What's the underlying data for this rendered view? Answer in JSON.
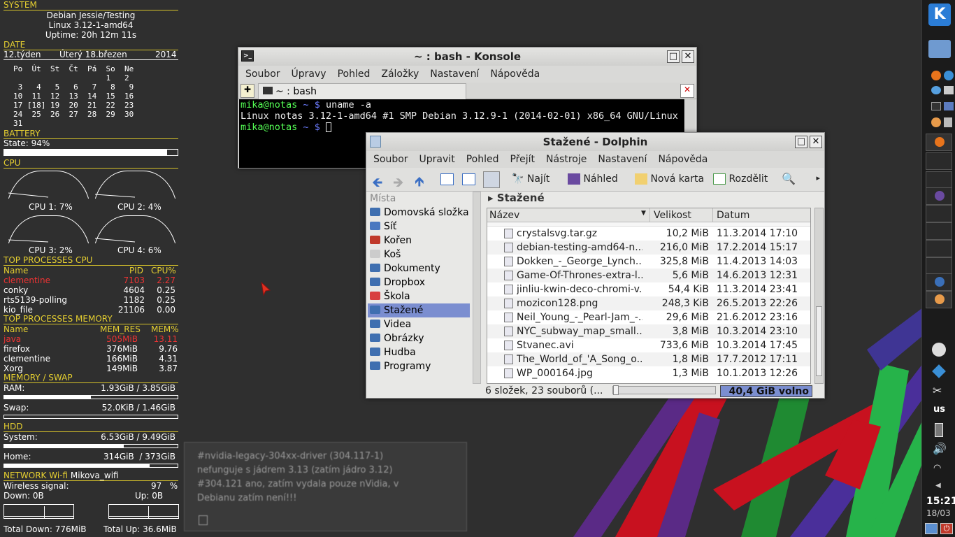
{
  "conky": {
    "system_title": "SYSTEM",
    "system_lines": [
      "Debian Jessie/Testing",
      "Linux 3.12-1-amd64",
      "Uptime: 20h 12m 11s"
    ],
    "date_title": "DATE",
    "week": "12.týden",
    "day": "Úterý 18.březen",
    "year": "2014",
    "calendar_head": "Po  Út  St  Čt  Pá  So  Ne",
    "calendar_rows": [
      "                    1   2",
      " 3   4   5   6   7   8   9",
      "10  11  12  13  14  15  16",
      "17 [18] 19  20  21  22  23",
      "24  25  26  27  28  29  30",
      "31"
    ],
    "battery_title": "BATTERY",
    "battery_state": "State: 94%",
    "battery_level": 0.94,
    "cpu_title": "CPU",
    "cpus": [
      {
        "label": "CPU 1: 7%",
        "value": 0.07
      },
      {
        "label": "CPU 2: 4%",
        "value": 0.04
      },
      {
        "label": "CPU 3: 2%",
        "value": 0.02
      },
      {
        "label": "CPU 4: 6%",
        "value": 0.06
      }
    ],
    "top_cpu_title": "TOP PROCESSES CPU",
    "top_cpu_head": [
      "Name",
      "PID",
      "CPU%"
    ],
    "top_cpu": [
      [
        "clementine",
        "7103",
        "2.27"
      ],
      [
        "conky",
        "4604",
        "0.25"
      ],
      [
        "rts5139-polling",
        "1182",
        "0.25"
      ],
      [
        "kio_file",
        "21106",
        "0.00"
      ]
    ],
    "top_mem_title": "TOP PROCESSES MEMORY",
    "top_mem_head": [
      "Name",
      "MEM_RES",
      "MEM%"
    ],
    "top_mem": [
      [
        "java",
        "505MiB",
        "13.11"
      ],
      [
        "firefox",
        "376MiB",
        "9.76"
      ],
      [
        "clementine",
        "166MiB",
        "4.31"
      ],
      [
        "Xorg",
        "149MiB",
        "3.87"
      ]
    ],
    "memswap_title": "MEMORY / SWAP",
    "ram_label": "RAM:",
    "ram_value": "1.93GiB / 3.85GiB",
    "ram_level": 0.5,
    "swap_label": "Swap:",
    "swap_value": "52.0KiB / 1.46GiB",
    "swap_level": 0.0,
    "hdd_title": "HDD",
    "sys_label": "System:",
    "sys_value": "6.53GiB / 9.49GiB",
    "sys_level": 0.69,
    "home_label": "Home:",
    "home_value": "314GiB  / 373GiB",
    "home_level": 0.84,
    "net_title": "NETWORK Wi-fi",
    "net_ssid": "Mikova_wifi",
    "wireless_label": "Wireless signal:",
    "wireless_value": "97   %",
    "down_label": "Down: 0B",
    "up_label": "Up: 0B",
    "total_down": "Total Down: 776MiB",
    "total_up": "Total Up: 36.6MiB"
  },
  "konsole": {
    "title": "~ : bash - Konsole",
    "menu": [
      "Soubor",
      "Úpravy",
      "Pohled",
      "Záložky",
      "Nastavení",
      "Nápověda"
    ],
    "tab": "~ : bash",
    "lines": [
      {
        "user": "mika",
        "host": "@notas",
        "path": " ~ ",
        "prompt": "$ ",
        "cmd": "uname -a"
      },
      {
        "out": "Linux notas 3.12-1-amd64 #1 SMP Debian 3.12.9-1 (2014-02-01) x86_64 GNU/Linux"
      },
      {
        "user": "mika",
        "host": "@notas",
        "path": " ~ ",
        "prompt": "$ ",
        "cmd": ""
      }
    ]
  },
  "dolphin": {
    "title": "Stažené - Dolphin",
    "menu": [
      "Soubor",
      "Upravit",
      "Pohled",
      "Přejít",
      "Nástroje",
      "Nastavení",
      "Nápověda"
    ],
    "toolbar": {
      "find": "Najít",
      "preview": "Náhled",
      "newtab": "Nová karta",
      "split": "Rozdělit"
    },
    "places_title": "Místa",
    "places": [
      "Domovská složka",
      "Síť",
      "Kořen",
      "Koš",
      "Dokumenty",
      "Dropbox",
      "Škola",
      "Stažené",
      "Videa",
      "Obrázky",
      "Hudba",
      "Programy"
    ],
    "selected_place": "Stažené",
    "breadcrumb": "Stažené",
    "columns": [
      "Název",
      "Velikost",
      "Datum"
    ],
    "files": [
      [
        "crystalsvg.tar.gz",
        "10,2 MiB",
        "11.3.2014 17:10"
      ],
      [
        "debian-testing-amd64-n...",
        "216,0 MiB",
        "17.2.2014 15:17"
      ],
      [
        "Dokken_-_George_Lynch...",
        "325,8 MiB",
        "11.4.2013 14:03"
      ],
      [
        "Game-Of-Thrones-extra-l...",
        "5,6 MiB",
        "14.6.2013 12:31"
      ],
      [
        "jinliu-kwin-deco-chromi-v...",
        "54,4 KiB",
        "11.3.2014 23:41"
      ],
      [
        "mozicon128.png",
        "248,3 KiB",
        "26.5.2013 22:26"
      ],
      [
        "Neil_Young_-_Pearl-Jam_-...",
        "29,6 MiB",
        "21.6.2012 23:16"
      ],
      [
        "NYC_subway_map_small....",
        "3,8 MiB",
        "10.3.2014 23:10"
      ],
      [
        "Stvanec.avi",
        "733,6 MiB",
        "10.3.2014 17:45"
      ],
      [
        "The_World_of_'A_Song_o...",
        "1,8 MiB",
        "17.7.2012 17:11"
      ],
      [
        "WP_000164.jpg",
        "1,3 MiB",
        "10.1.2013 12:26"
      ]
    ],
    "status": "6 složek, 23 souborů (...",
    "free": "40,4 GiB volno"
  },
  "note": {
    "lines": [
      "#nvidia-legacy-304xx-driver (304.117-1)",
      "nefunguje s jádrem 3.13  (zatím jádro 3.12)",
      "#304.121 ano, zatím vydala pouze nVidia, v",
      "Debianu zatím není!!!"
    ]
  },
  "panel": {
    "keyboard": "us",
    "time": "15:21",
    "date": "18/03"
  },
  "colors": {
    "conky_accent": "#e5cf30",
    "selection": "#7b8ed0",
    "term_green": "#55ff55",
    "term_blue": "#5c6cff"
  }
}
